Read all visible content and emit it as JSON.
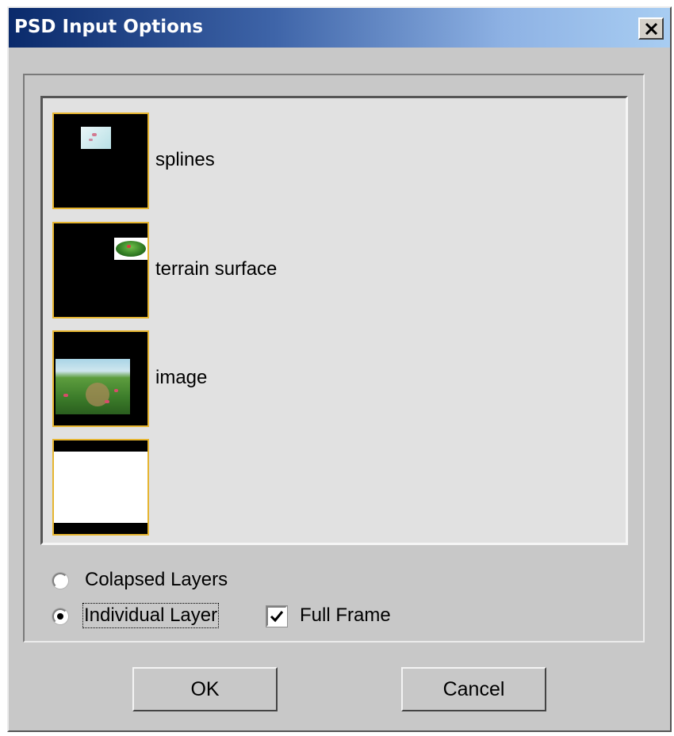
{
  "window": {
    "title": "PSD Input Options"
  },
  "layers": [
    {
      "label": "splines",
      "thumb": "small-sky-preview"
    },
    {
      "label": "terrain surface",
      "thumb": "terrain-preview"
    },
    {
      "label": "image",
      "thumb": "landscape-preview"
    },
    {
      "label": "",
      "thumb": "white-frame-preview"
    }
  ],
  "options": {
    "collapsed_label": "Colapsed Layers",
    "individual_label": "Individual Layer",
    "selected": "Individual Layer",
    "full_frame_label": "Full Frame",
    "full_frame_checked": true
  },
  "buttons": {
    "ok": "OK",
    "cancel": "Cancel"
  },
  "colors": {
    "thumb_border": "#e6b530",
    "title_dark": "#0a2a6b",
    "title_light": "#a8cdf2"
  }
}
